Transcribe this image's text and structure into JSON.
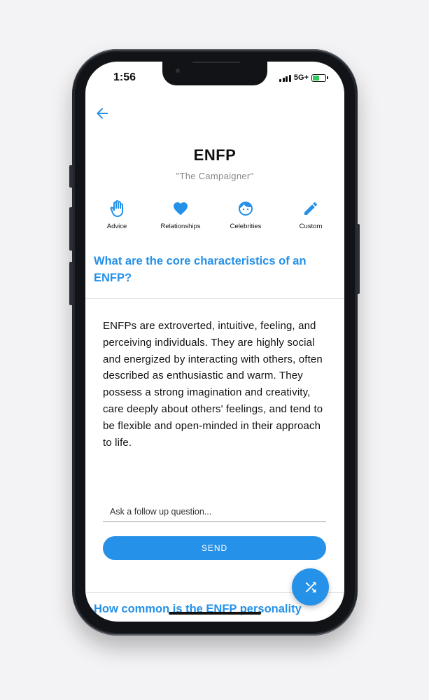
{
  "status_bar": {
    "time": "1:56",
    "network": "5G+"
  },
  "header": {
    "title": "ENFP",
    "subtitle": "\"The Campaigner\""
  },
  "actions": [
    {
      "label": "Advice",
      "icon": "hand-icon"
    },
    {
      "label": "Relationships",
      "icon": "heart-icon"
    },
    {
      "label": "Celebrities",
      "icon": "face-icon"
    },
    {
      "label": "Custom",
      "icon": "pencil-icon"
    }
  ],
  "question": {
    "text": "What are the core characteristics of an ENFP?",
    "answer": "ENFPs are extroverted, intuitive, feeling, and perceiving individuals. They are highly social and energized by interacting with others, often described as enthusiastic and warm. They possess a strong imagination and creativity, care deeply about others' feelings, and tend to be flexible and open-minded in their approach to life."
  },
  "followup": {
    "placeholder": "Ask a follow up question...",
    "value": ""
  },
  "send_label": "SEND",
  "next_question": "How common is the ENFP personality",
  "colors": {
    "accent": "#2591e8",
    "text": "#111111",
    "muted": "#888888"
  }
}
